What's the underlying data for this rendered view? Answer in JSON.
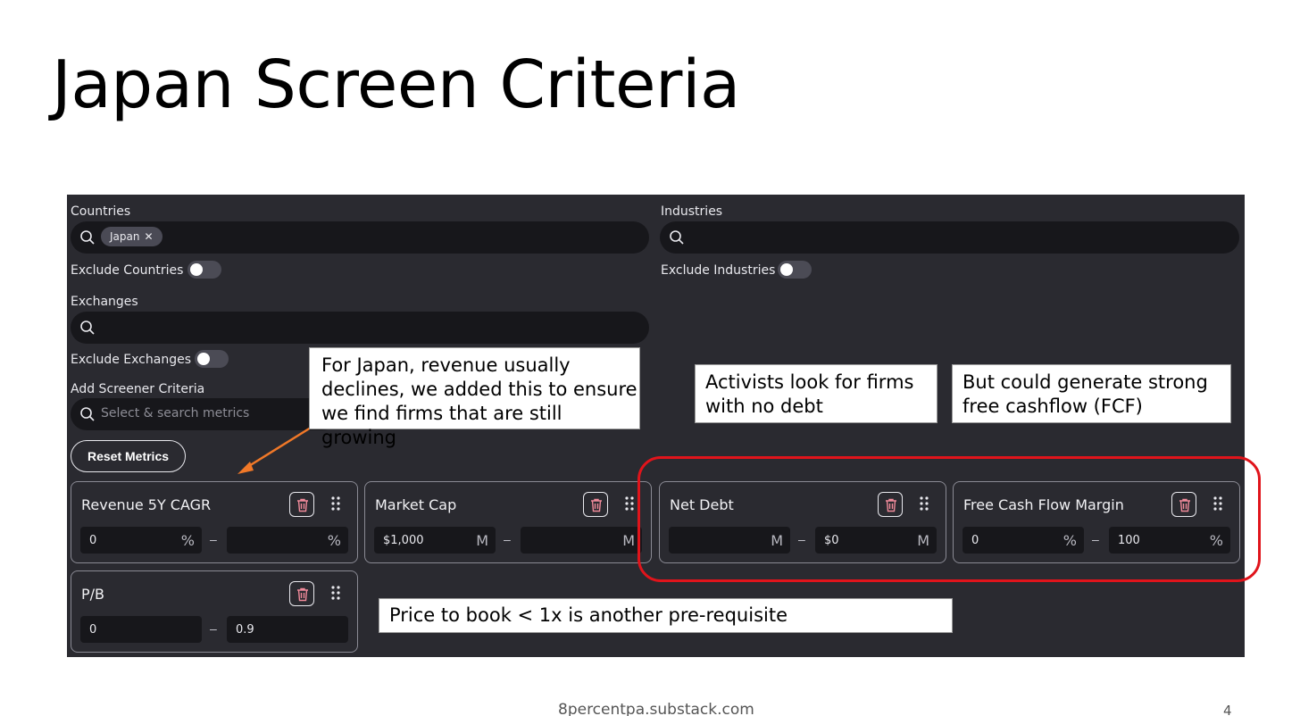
{
  "slide": {
    "title": "Japan Screen Criteria",
    "footer": "8percentpa.substack.com",
    "page_number": "4"
  },
  "screener": {
    "countries": {
      "label": "Countries",
      "chip": "Japan",
      "chip_close": "✕"
    },
    "industries": {
      "label": "Industries"
    },
    "exclude_countries": {
      "label": "Exclude Countries",
      "on": false
    },
    "exclude_industries": {
      "label": "Exclude Industries",
      "on": false
    },
    "exchanges": {
      "label": "Exchanges"
    },
    "exclude_exchanges": {
      "label": "Exclude Exchanges",
      "on": false
    },
    "add_criteria": {
      "label": "Add Screener Criteria",
      "placeholder": "Select & search metrics"
    },
    "reset_button": "Reset Metrics",
    "dash": "–",
    "cards": [
      {
        "title": "Revenue 5Y CAGR",
        "min": "0",
        "min_unit": "%",
        "max": "",
        "max_unit": "%"
      },
      {
        "title": "Market Cap",
        "min": "$1,000",
        "min_unit": "M",
        "max": "",
        "max_unit": "M"
      },
      {
        "title": "Net Debt",
        "min": "",
        "min_unit": "M",
        "max": "$0",
        "max_unit": "M"
      },
      {
        "title": "Free Cash Flow Margin",
        "min": "0",
        "min_unit": "%",
        "max": "100",
        "max_unit": "%"
      },
      {
        "title": "P/B",
        "min": "0",
        "min_unit": "",
        "max": "0.9",
        "max_unit": ""
      }
    ]
  },
  "annotations": {
    "revenue_note": [
      "For Japan, revenue usually",
      "declines, we added this to ensure",
      "we find firms that are still growing"
    ],
    "activists_note": [
      "Activists look for firms",
      "with no debt"
    ],
    "fcf_note": [
      "But could generate strong",
      "free cashflow (FCF)"
    ],
    "pb_note": "Price to book < 1x is another pre-requisite"
  },
  "colors": {
    "panel_bg": "#2a2a30",
    "input_bg": "#17171b",
    "highlight_red": "#e0141b",
    "arrow_orange": "#f07828"
  }
}
